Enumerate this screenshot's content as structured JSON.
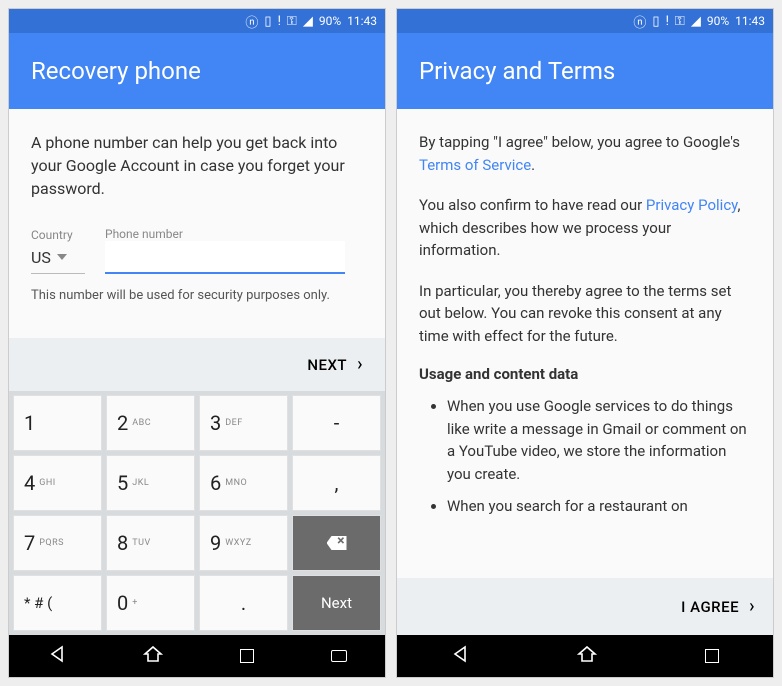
{
  "status": {
    "battery": "90%",
    "time": "11:43"
  },
  "screen1": {
    "title": "Recovery phone",
    "desc": "A phone number can help you get back into your Google Account in case you forget your password.",
    "country_label": "Country",
    "phone_label": "Phone number",
    "country_value": "US",
    "phone_value": "",
    "hint": "This number will be used for security purposes only.",
    "next": "NEXT",
    "keys": {
      "k1": "1",
      "k2": "2",
      "k2s": "ABC",
      "k3": "3",
      "k3s": "DEF",
      "kd": "-",
      "k4": "4",
      "k4s": "GHI",
      "k5": "5",
      "k5s": "JKL",
      "k6": "6",
      "k6s": "MNO",
      "kc": ",",
      "k7": "7",
      "k7s": "PQRS",
      "k8": "8",
      "k8s": "TUV",
      "k9": "9",
      "k9s": "WXYZ",
      "ks": "* # (",
      "k0": "0",
      "k0s": "+",
      "kp": ".",
      "kn": "Next"
    }
  },
  "screen2": {
    "title": "Privacy and Terms",
    "p1a": "By tapping \"I agree\" below, you agree to Google's ",
    "p1link": "Terms of Service",
    "p1b": ".",
    "p2a": "You also confirm to have read our ",
    "p2link": "Privacy Policy",
    "p2b": ", which describes how we process your information.",
    "p3": "In particular, you thereby agree to the terms set out below. You can revoke this consent at any time with effect for the future.",
    "subhead": "Usage and content data",
    "li1": "When you use Google services to do things like write a message in Gmail or comment on a YouTube video, we store the information you create.",
    "li2": "When you search for a restaurant on",
    "agree": "I AGREE"
  }
}
